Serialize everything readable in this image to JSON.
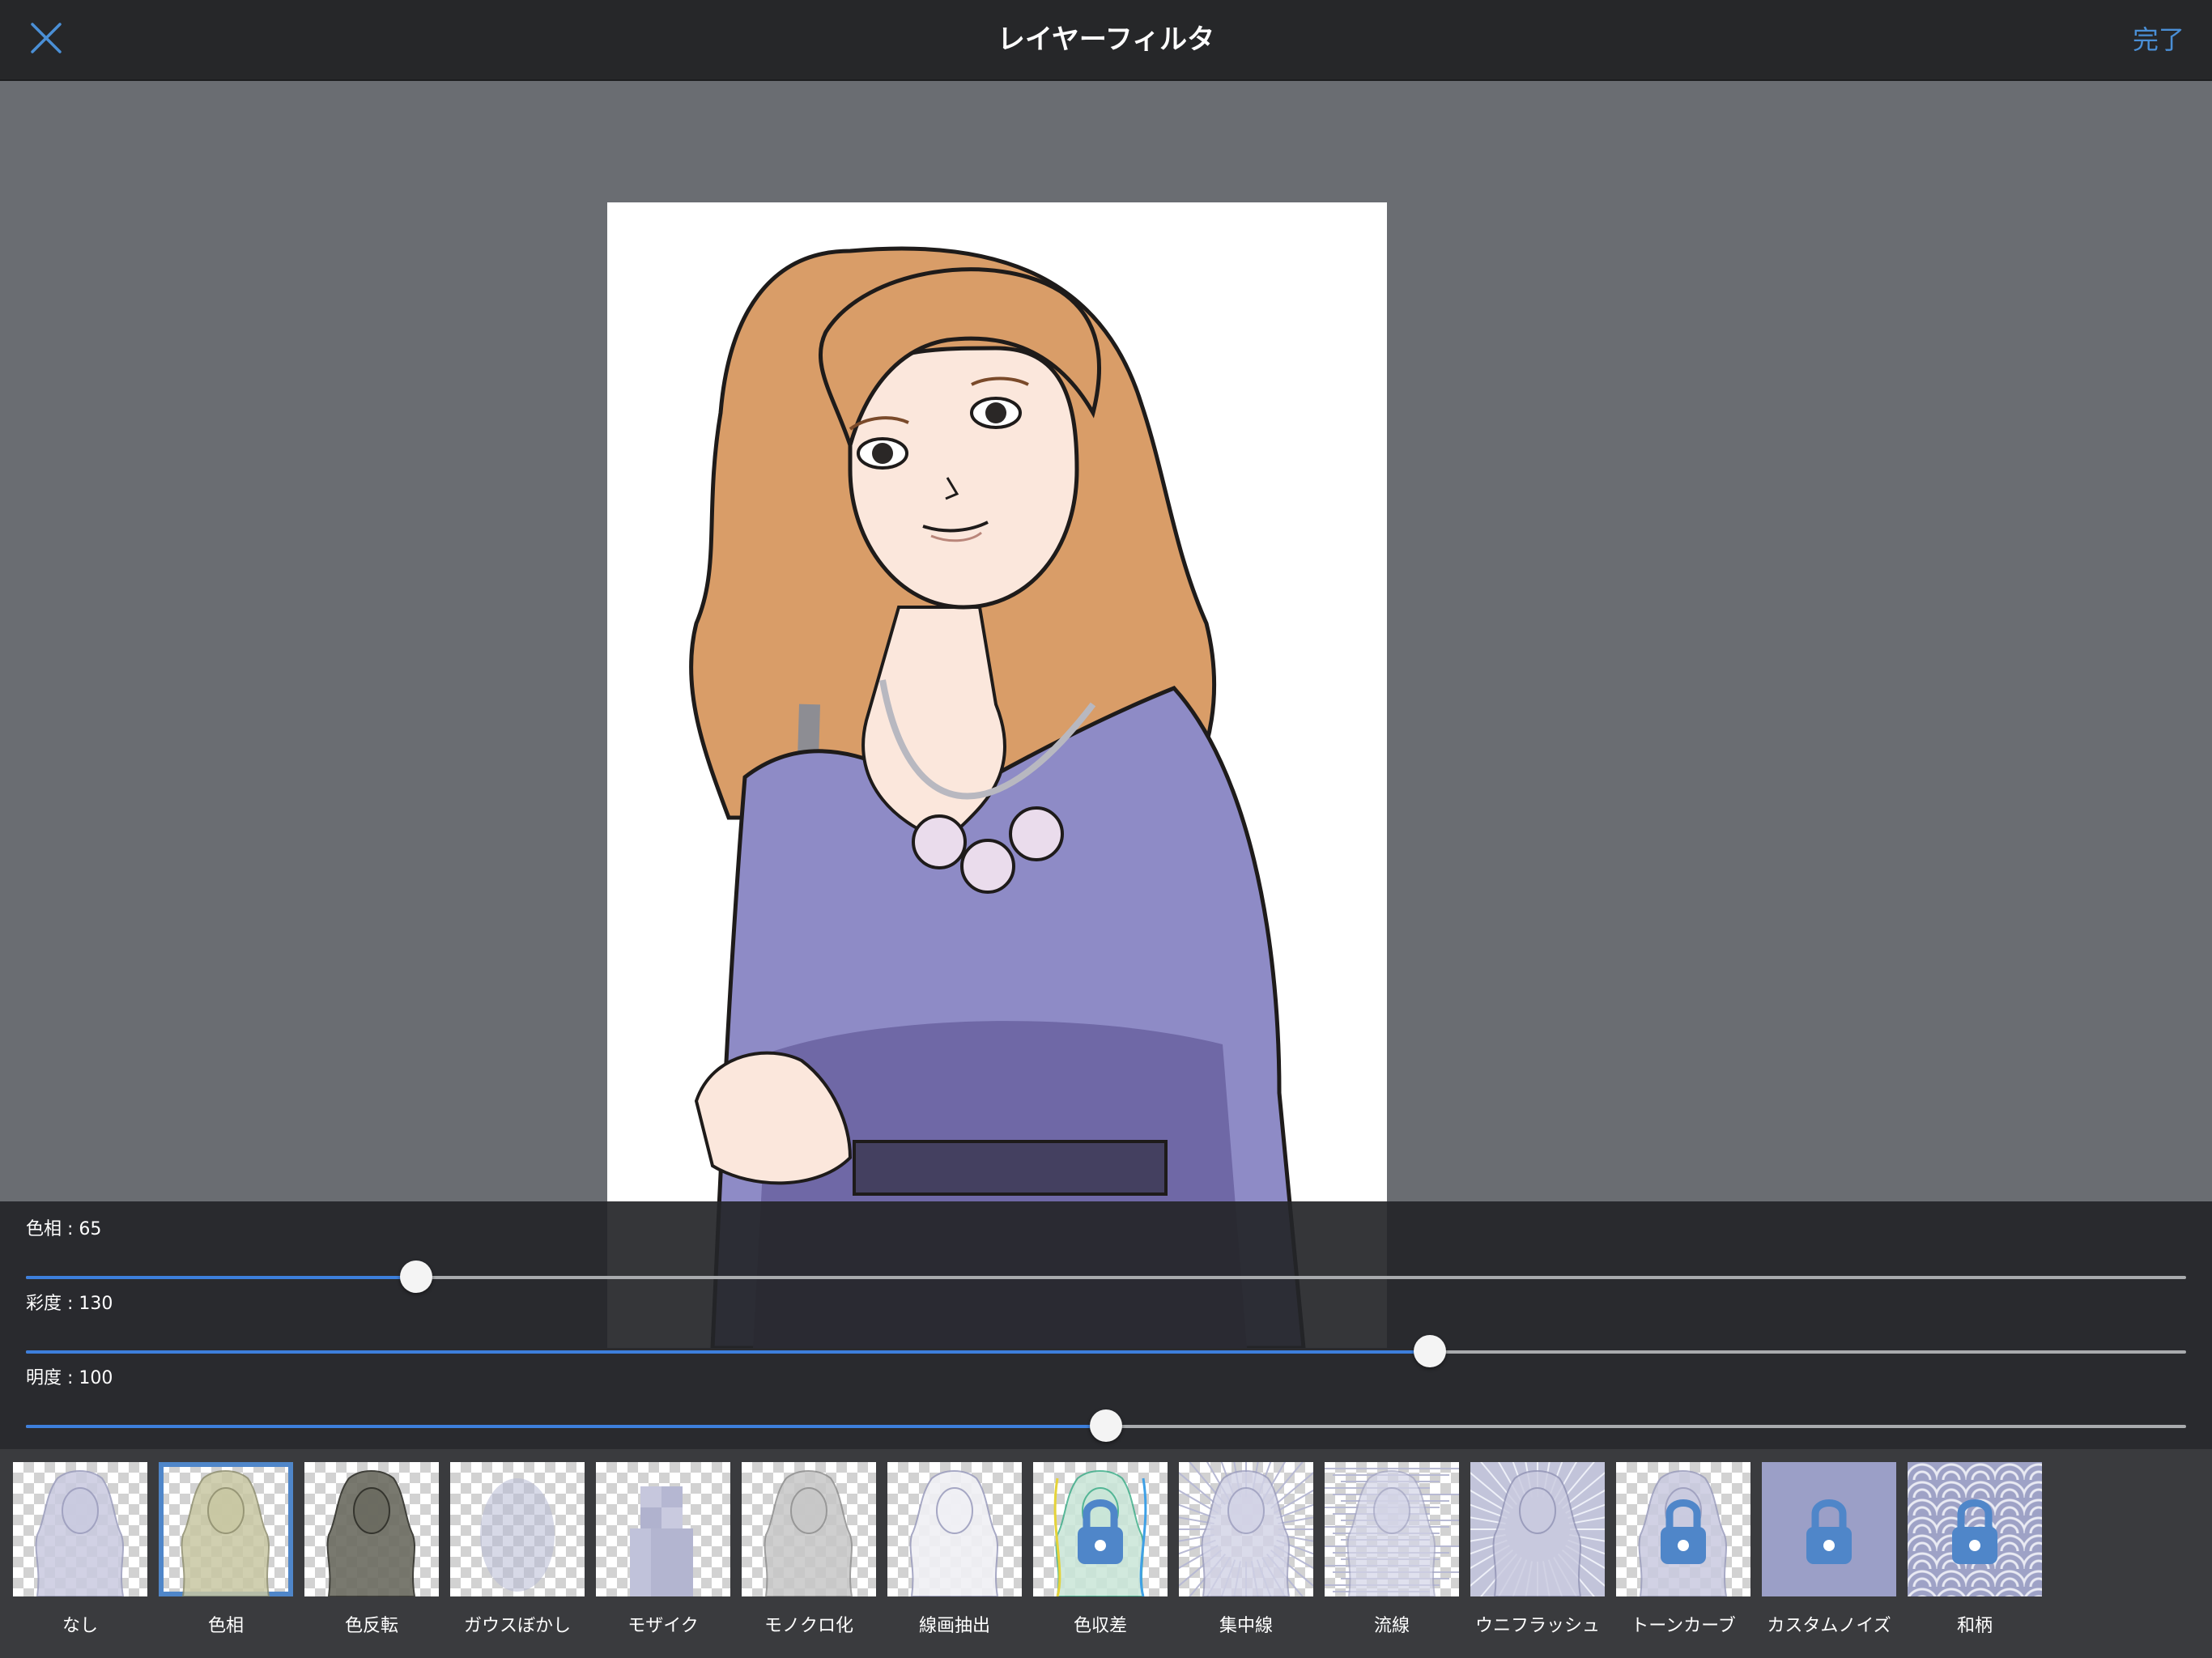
{
  "header": {
    "title": "レイヤーフィルタ",
    "done_label": "完了",
    "close_icon": "close-icon"
  },
  "colors": {
    "accent": "#4a8fd6",
    "slider_fill": "#3d7fdc",
    "selected_outline": "#4f86c9"
  },
  "sliders": [
    {
      "id": "hue",
      "label": "色相 : 65",
      "value": 65,
      "min": 0,
      "max": 360
    },
    {
      "id": "saturation",
      "label": "彩度 : 130",
      "value": 130,
      "min": 0,
      "max": 200
    },
    {
      "id": "brightness",
      "label": "明度 : 100",
      "value": 100,
      "min": 0,
      "max": 200
    }
  ],
  "filters": [
    {
      "label": "なし",
      "style": "figure",
      "selected": false,
      "locked": false
    },
    {
      "label": "色相",
      "style": "hue",
      "selected": true,
      "locked": false
    },
    {
      "label": "色反転",
      "style": "invert",
      "selected": false,
      "locked": false
    },
    {
      "label": "ガウスぼかし",
      "style": "blur",
      "selected": false,
      "locked": false
    },
    {
      "label": "モザイク",
      "style": "mosaic",
      "selected": false,
      "locked": false
    },
    {
      "label": "モノクロ化",
      "style": "mono",
      "selected": false,
      "locked": false
    },
    {
      "label": "線画抽出",
      "style": "lineart",
      "selected": false,
      "locked": false
    },
    {
      "label": "色収差",
      "style": "aberration",
      "selected": false,
      "locked": true
    },
    {
      "label": "集中線",
      "style": "speedlines",
      "selected": false,
      "locked": false
    },
    {
      "label": "流線",
      "style": "flowlines",
      "selected": false,
      "locked": false
    },
    {
      "label": "ウニフラッシュ",
      "style": "flash",
      "selected": false,
      "locked": false
    },
    {
      "label": "トーンカーブ",
      "style": "figure",
      "selected": false,
      "locked": true
    },
    {
      "label": "カスタムノイズ",
      "style": "solid",
      "selected": false,
      "locked": true
    },
    {
      "label": "和柄",
      "style": "waves",
      "selected": false,
      "locked": true
    }
  ]
}
